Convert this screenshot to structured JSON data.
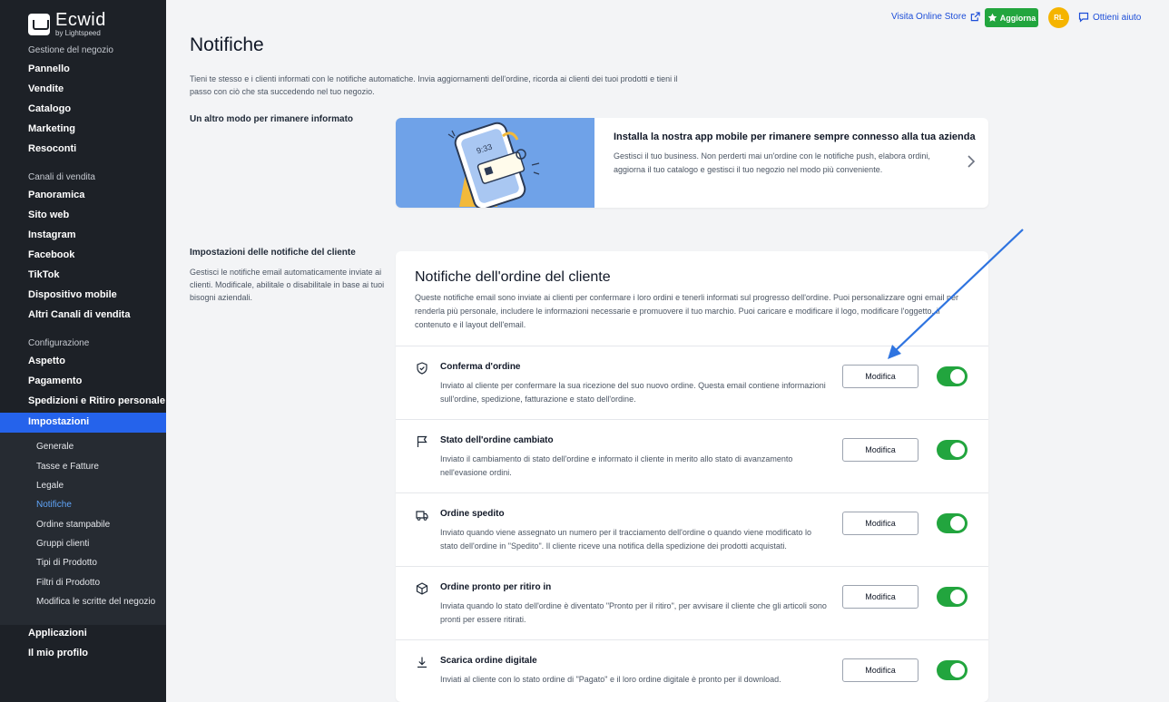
{
  "sidebar": {
    "logo_name": "Ecwid",
    "logo_sub": "by Lightspeed",
    "section_store": "Gestione del negozio",
    "items_store": [
      "Pannello",
      "Vendite",
      "Catalogo",
      "Marketing",
      "Resoconti"
    ],
    "section_channels": "Canali di vendita",
    "items_channels": [
      "Panoramica",
      "Sito web",
      "Instagram",
      "Facebook",
      "TikTok",
      "Dispositivo mobile",
      "Altri Canali di vendita"
    ],
    "section_config": "Configurazione",
    "items_config": [
      "Aspetto",
      "Pagamento",
      "Spedizioni e Ritiro personale",
      "Impostazioni"
    ],
    "sub_items": [
      "Generale",
      "Tasse e Fatture",
      "Legale",
      "Notifiche",
      "Ordine stampabile",
      "Gruppi clienti",
      "Tipi di Prodotto",
      "Filtri di Prodotto",
      "Modifica le scritte del negozio"
    ],
    "active_sub": "Notifiche",
    "items_bottom": [
      "Applicazioni",
      "Il mio profilo"
    ]
  },
  "topbar": {
    "visit_store": "Visita Online Store",
    "upgrade": "Aggiorna",
    "avatar_initials": "RL",
    "help": "Ottieni aiuto"
  },
  "page": {
    "title": "Notifiche",
    "description": "Tieni te stesso e i clienti informati con le notifiche automatiche. Invia aggiornamenti dell'ordine, ricorda ai clienti dei tuoi prodotti e tieni il passo con ciò che sta succedendo nel tuo negozio."
  },
  "app_section": {
    "label": "Un altro modo per rimanere informato",
    "banner_title": "Installa la nostra app mobile per rimanere sempre connesso alla tua azienda",
    "banner_desc": "Gestisci il tuo business. Non perderti mai un'ordine con le notifiche push, elabora ordini, aggiorna il tuo catalogo e gestisci il tuo negozio nel modo più conveniente.",
    "phone_time": "9:33"
  },
  "customer_section": {
    "label": "Impostazioni delle notifiche del cliente",
    "desc": "Gestisci le notifiche email automaticamente inviate ai clienti. Modificale, abilitale o disabilitale in base ai tuoi bisogni aziendali.",
    "card_title": "Notifiche dell'ordine del cliente",
    "card_desc": "Queste notifiche email sono inviate ai clienti per confermare i loro ordini e tenerli informati sul progresso dell'ordine. Puoi personalizzare ogni email per renderla più personale, includere le informazioni necessarie e promuovere il tuo marchio. Puoi caricare e modificare il logo, modificare l'oggetto, il contenuto e il layout dell'email.",
    "edit_label": "Modifica",
    "rows": [
      {
        "title": "Conferma d'ordine",
        "desc": "Inviato al cliente per confermare la sua ricezione del suo nuovo ordine. Questa email contiene informazioni sull'ordine, spedizione, fatturazione e stato dell'ordine.",
        "icon": "shield-check-icon",
        "enabled": true
      },
      {
        "title": "Stato dell'ordine cambiato",
        "desc": "Inviato il cambiamento di stato dell'ordine e informato il cliente in merito allo stato di avanzamento nell'evasione ordini.",
        "icon": "flag-icon",
        "enabled": true
      },
      {
        "title": "Ordine spedito",
        "desc": "Inviato quando viene assegnato un numero per il tracciamento dell'ordine o quando viene modificato lo stato dell'ordine in \"Spedito\". Il cliente riceve una notifica della spedizione dei prodotti acquistati.",
        "icon": "truck-icon",
        "enabled": true
      },
      {
        "title": "Ordine pronto per ritiro in",
        "desc": "Inviata quando lo stato dell'ordine è diventato \"Pronto per il ritiro\", per avvisare il cliente che gli articoli sono pronti per essere ritirati.",
        "icon": "package-icon",
        "enabled": true
      },
      {
        "title": "Scarica ordine digitale",
        "desc": "Inviati al cliente con lo stato ordine di \"Pagato\" e il loro ordine digitale è pronto per il download.",
        "icon": "download-icon",
        "enabled": true
      }
    ]
  },
  "colors": {
    "sidebar_bg": "#1d2127",
    "active_nav": "#2563eb",
    "toggle_on": "#22a53e",
    "annotation_arrow": "#2f74e0"
  }
}
